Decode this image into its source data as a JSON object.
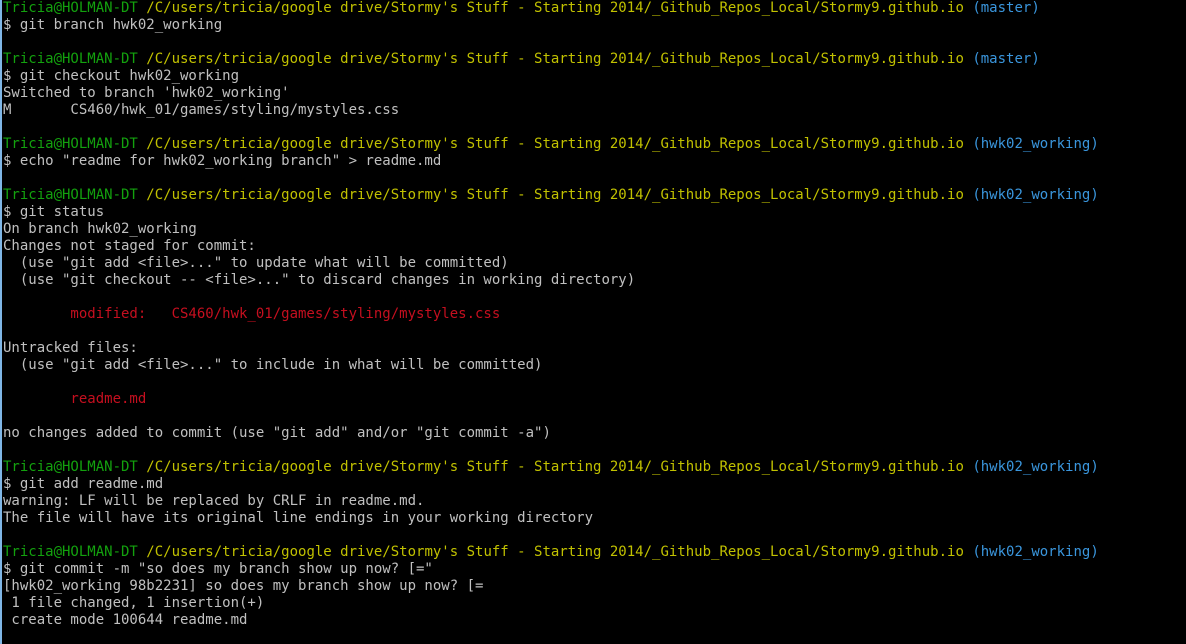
{
  "prompt": {
    "user": "Tricia@HOLMAN-DT",
    "path": "/C/users/tricia/google drive/Stormy's Stuff - Starting 2014/_Github_Repos_Local/Stormy9.github.io"
  },
  "colors": {
    "background": "#000000",
    "text": "#c0c0c0",
    "user": "#13a10e",
    "path": "#c1c100",
    "branch": "#3a96dd",
    "error": "#c50f1f"
  },
  "lines": [
    {
      "type": "prompt",
      "branch": "(master)"
    },
    {
      "type": "text",
      "text": "$ git branch hwk02_working"
    },
    {
      "type": "blank"
    },
    {
      "type": "prompt",
      "branch": "(master)"
    },
    {
      "type": "text",
      "text": "$ git checkout hwk02_working"
    },
    {
      "type": "text",
      "text": "Switched to branch 'hwk02_working'"
    },
    {
      "type": "text",
      "text": "M       CS460/hwk_01/games/styling/mystyles.css"
    },
    {
      "type": "blank"
    },
    {
      "type": "prompt",
      "branch": "(hwk02_working)"
    },
    {
      "type": "text",
      "text": "$ echo \"readme for hwk02_working branch\" > readme.md"
    },
    {
      "type": "blank"
    },
    {
      "type": "prompt",
      "branch": "(hwk02_working)"
    },
    {
      "type": "text",
      "text": "$ git status"
    },
    {
      "type": "text",
      "text": "On branch hwk02_working"
    },
    {
      "type": "text",
      "text": "Changes not staged for commit:"
    },
    {
      "type": "text",
      "text": "  (use \"git add <file>...\" to update what will be committed)"
    },
    {
      "type": "text",
      "text": "  (use \"git checkout -- <file>...\" to discard changes in working directory)"
    },
    {
      "type": "blank"
    },
    {
      "type": "red",
      "text": "        modified:   CS460/hwk_01/games/styling/mystyles.css"
    },
    {
      "type": "blank"
    },
    {
      "type": "text",
      "text": "Untracked files:"
    },
    {
      "type": "text",
      "text": "  (use \"git add <file>...\" to include in what will be committed)"
    },
    {
      "type": "blank"
    },
    {
      "type": "red",
      "text": "        readme.md"
    },
    {
      "type": "blank"
    },
    {
      "type": "text",
      "text": "no changes added to commit (use \"git add\" and/or \"git commit -a\")"
    },
    {
      "type": "blank"
    },
    {
      "type": "prompt",
      "branch": "(hwk02_working)"
    },
    {
      "type": "text",
      "text": "$ git add readme.md"
    },
    {
      "type": "text",
      "text": "warning: LF will be replaced by CRLF in readme.md."
    },
    {
      "type": "text",
      "text": "The file will have its original line endings in your working directory"
    },
    {
      "type": "blank"
    },
    {
      "type": "prompt",
      "branch": "(hwk02_working)"
    },
    {
      "type": "text",
      "text": "$ git commit -m \"so does my branch show up now? [=\""
    },
    {
      "type": "text",
      "text": "[hwk02_working 98b2231] so does my branch show up now? [="
    },
    {
      "type": "text",
      "text": " 1 file changed, 1 insertion(+)"
    },
    {
      "type": "text",
      "text": " create mode 100644 readme.md"
    }
  ]
}
